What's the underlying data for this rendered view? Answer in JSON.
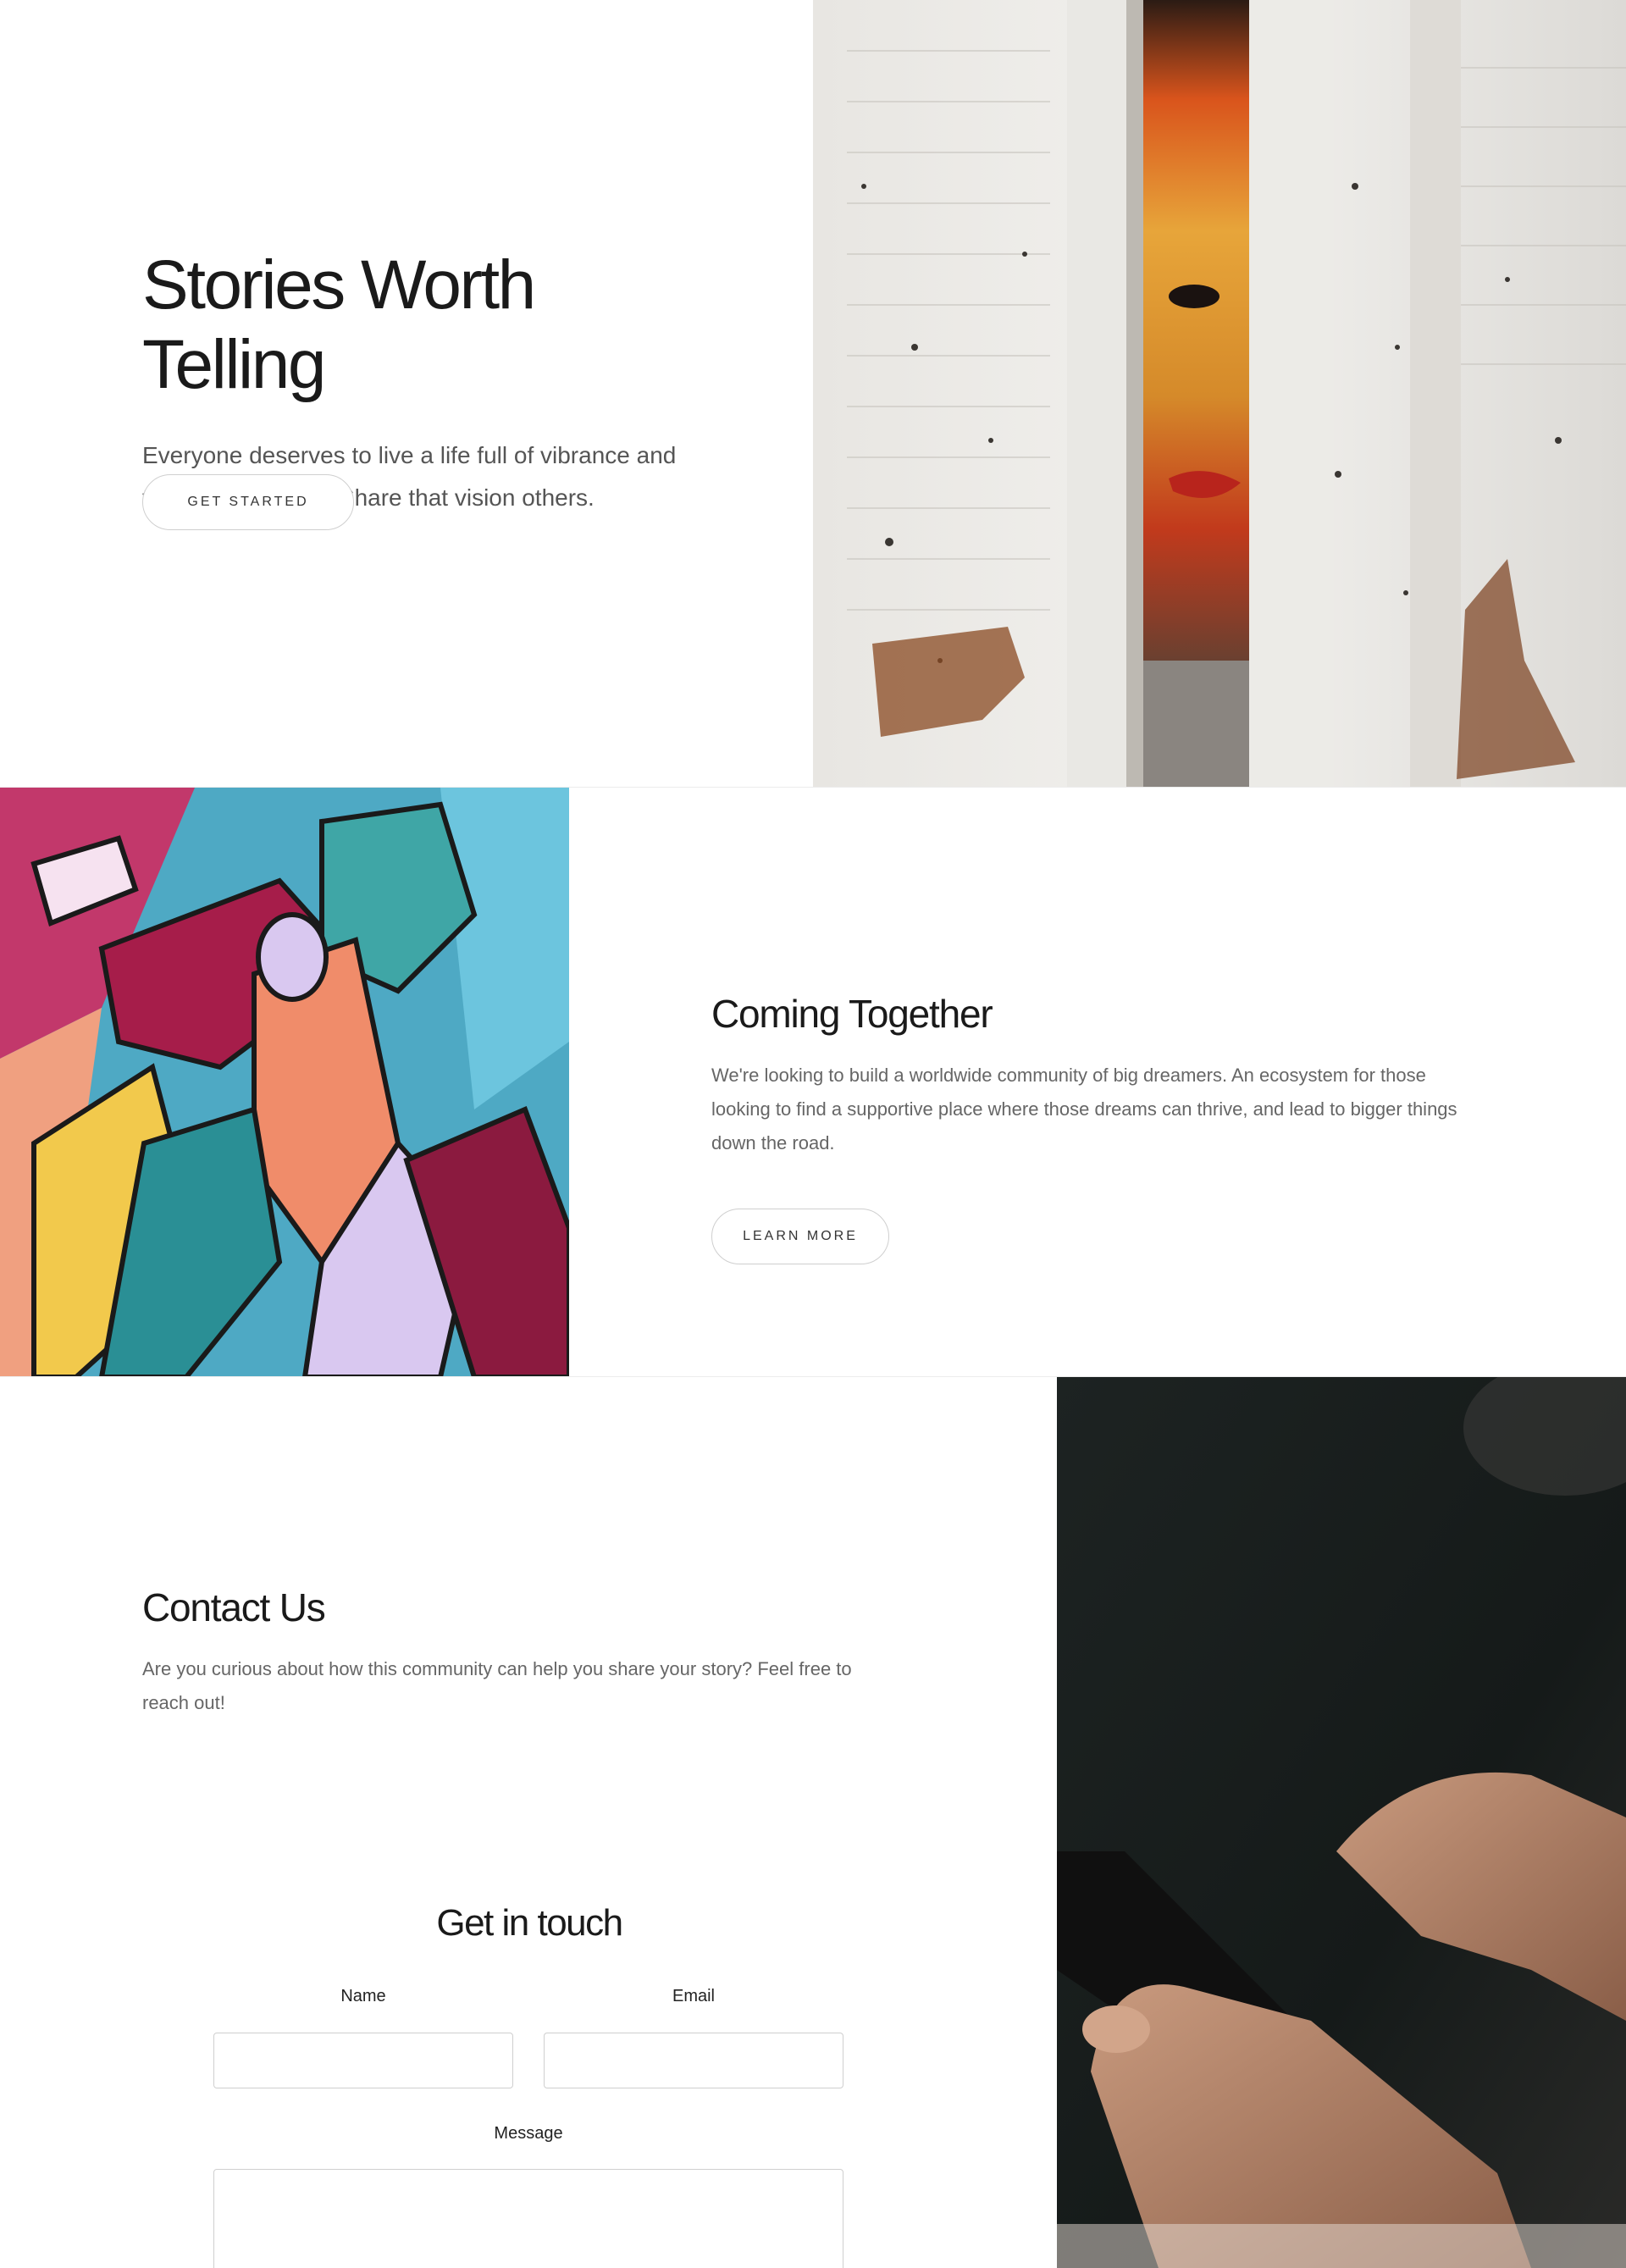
{
  "hero": {
    "title": "Stories Worth Telling",
    "subtitle": "Everyone deserves to live a life full of vibrance and tales worth telling. Share that vision others.",
    "cta_label": "GET STARTED",
    "image": "street-mural-wall-photo"
  },
  "community": {
    "title": "Coming Together",
    "body": "We're looking to build a worldwide community of big dreamers. An ecosystem for those looking to find a supportive place where those dreams can thrive, and lead to bigger things down the road.",
    "cta_label": "LEARN MORE",
    "image": "colorful-hands-mural-photo"
  },
  "contact": {
    "title": "Contact Us",
    "body": "Are you curious about how this community can help you share your story? Feel free to reach out!",
    "image": "hands-holding-phone-photo",
    "form": {
      "title": "Get in touch",
      "name_label": "Name",
      "email_label": "Email",
      "message_label": "Message",
      "name_value": "",
      "email_value": "",
      "message_value": ""
    }
  },
  "colors": {
    "background": "#ffffff",
    "heading": "#1a1a1a",
    "body_text": "#666666",
    "button_border": "#cfcfcf"
  }
}
